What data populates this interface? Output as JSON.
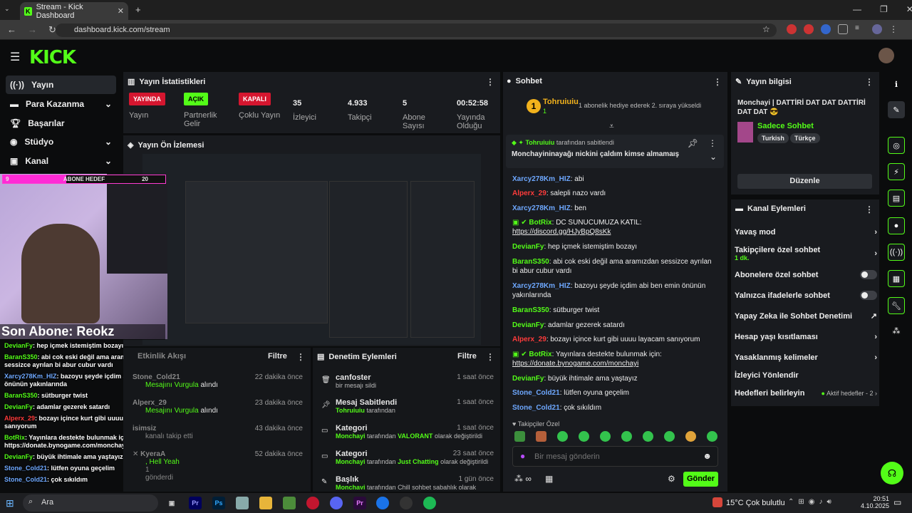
{
  "browser": {
    "tab_title": "Stream - Kick Dashboard",
    "url": "dashboard.kick.com/stream"
  },
  "brand": {
    "logo": "KICK",
    "accent": "#53fc18"
  },
  "sidebar": {
    "items": [
      {
        "label": "Yayın"
      },
      {
        "label": "Para Kazanma"
      },
      {
        "label": "Başarılar"
      },
      {
        "label": "Stüdyo"
      },
      {
        "label": "Kanal"
      }
    ]
  },
  "stats": {
    "title": "Yayın İstatistikleri",
    "items": [
      {
        "badge": "YAYINDA",
        "label": "Yayın"
      },
      {
        "badge": "AÇIK",
        "label": "Partnerlik Gelir"
      },
      {
        "badge": "KAPALI",
        "label": "Çoklu Yayın"
      },
      {
        "value": "35",
        "label": "İzleyici"
      },
      {
        "value": "4.933",
        "label": "Takipçi"
      },
      {
        "value": "5",
        "label": "Abone Sayısı"
      },
      {
        "value": "00:52:58",
        "label": "Yayında Olduğu"
      }
    ]
  },
  "preview": {
    "title": "Yayın Ön İzlemesi"
  },
  "overlay": {
    "goal_count": "9",
    "goal_label": "ABONE HEDEF",
    "goal_target": "20",
    "last_sub": "Son Abone: Reokz",
    "chat": [
      {
        "user": "DevianFy",
        "text": "hep içmek istemiştim bozayı"
      },
      {
        "user": "BaranS350",
        "text": "abi cok eski değil ama aramızdan sessizce ayrılan bi abur cubur vardı"
      },
      {
        "user": "Xarcy278Km_HIZ",
        "text": "bazoyu şeyde içdim abi ben emin önünün yakınlarında"
      },
      {
        "user": "BaranS350",
        "text": "sütburger twist"
      },
      {
        "user": "DevianFy",
        "text": "adamlar gezerek satardı"
      },
      {
        "user": "Alperx_29",
        "text": "bozayı içince kurt gibi uuuu layacam sanıyorum"
      },
      {
        "user": "BotRix",
        "text": "Yayınlara destekte bulunmak için: https://donate.bynogame.com/monchayi"
      },
      {
        "user": "DevianFy",
        "text": "büyük ihtimale ama yaştayız"
      },
      {
        "user": "Stone_Cold21",
        "text": "lütfen oyuna geçelim"
      },
      {
        "user": "Stone_Cold21",
        "text": "çok sıkıldım"
      }
    ]
  },
  "feed": {
    "title": "Etkinlik Akışı",
    "filter": "Filtre",
    "items": [
      {
        "user": "Stone_Cold21",
        "action": "Mesajını Vurgula",
        "suffix": "alındı",
        "time": "22 dakika önce"
      },
      {
        "user": "Alperx_29",
        "action": "Mesajını Vurgula",
        "suffix": "alındı",
        "time": "23 dakika önce"
      },
      {
        "user": "isimsiz",
        "action": "kanalı takip etti",
        "time": "43 dakika önce"
      },
      {
        "user": "KyeraA",
        "action": ", Hell Yeah",
        "extra": "1",
        "suffix": "gönderdi",
        "time": "52 dakika önce"
      }
    ]
  },
  "moderation": {
    "title": "Denetim Eylemleri",
    "filter": "Filtre",
    "items": [
      {
        "title": "canfoster",
        "desc": "bir mesajı sildi",
        "time": "1 saat önce"
      },
      {
        "title": "Mesaj Sabitlendi",
        "user": "Tohruiuiu",
        "desc": "tarafından",
        "time": "1 saat önce"
      },
      {
        "title": "Kategori",
        "user": "Monchayi",
        "desc": "tarafından",
        "hl": "VALORANT",
        "desc2": "olarak değiştirildi",
        "time": "1 saat önce"
      },
      {
        "title": "Kategori",
        "user": "Monchayi",
        "desc": "tarafından",
        "hl": "Just Chatting",
        "desc2": "olarak değiştirildi",
        "time": "23 saat önce"
      },
      {
        "title": "Başlık",
        "user": "Monchayi",
        "desc": "tarafından Chill sohbet sabahlık olarak",
        "time": "1 gün önce"
      }
    ]
  },
  "chat": {
    "title": "Sohbet",
    "gift_user": "Tohruiuiu",
    "gift_count": "1",
    "gift_text": "1 abonelik hediye ederek 2. sıraya yükseldi",
    "pinned_by": "Tohruiuiu",
    "pinned_suffix": "tarafından sabitlendi",
    "pinned_text": "Monchayininayağı nickini çaldım kimse almamaış",
    "messages": [
      {
        "user": "Xarcy278Km_HIZ",
        "color": "#6ea8ff",
        "text": "abi"
      },
      {
        "user": "Alperx_29",
        "color": "#ff3b3b",
        "text": "salepli nazo vardı"
      },
      {
        "user": "Xarcy278Km_HIZ",
        "color": "#6ea8ff",
        "text": "ben"
      },
      {
        "user": "BotRix",
        "color": "#53fc18",
        "text": "DC SUNUCUMUZA KATIL:",
        "link": "https://discord.gg/HJyBpQ8sKk"
      },
      {
        "user": "DevianFy",
        "color": "#53fc18",
        "text": "hep içmek istemiştim bozayı"
      },
      {
        "user": "BaranS350",
        "color": "#53fc18",
        "text": "abi cok eski değil ama aramızdan sessizce ayrılan bi abur cubur vardı"
      },
      {
        "user": "Xarcy278Km_HIZ",
        "color": "#6ea8ff",
        "text": "bazoyu şeyde içdim abi ben emin önünün yakınlarında"
      },
      {
        "user": "BaranS350",
        "color": "#53fc18",
        "text": "sütburger twist"
      },
      {
        "user": "DevianFy",
        "color": "#53fc18",
        "text": "adamlar gezerek satardı"
      },
      {
        "user": "Alperx_29",
        "color": "#ff3b3b",
        "text": "bozayı içince kurt gibi uuuu layacam sanıyorum"
      },
      {
        "user": "BotRix",
        "color": "#53fc18",
        "text": "Yayınlara destekte bulunmak için:",
        "link": "https://donate.bynogame.com/monchayi"
      },
      {
        "user": "DevianFy",
        "color": "#53fc18",
        "text": "büyük ihtimale ama yaştayız"
      },
      {
        "user": "Stone_Cold21",
        "color": "#6ea8ff",
        "text": "lütfen oyuna geçelim"
      },
      {
        "user": "Stone_Cold21",
        "color": "#6ea8ff",
        "text": "çok sıkıldım"
      }
    ],
    "follower_only": "Takipçiler Özel",
    "placeholder": "Bir mesaj gönderin",
    "send": "Gönder"
  },
  "info": {
    "title": "Yayın bilgisi",
    "stream_title": "Monchayi | DATTİRİ DAT DAT DATTİRİ DAT DAT 😎",
    "category": "Sadece Sohbet",
    "tags": [
      "Turkish",
      "Türkçe"
    ],
    "edit": "Düzenle"
  },
  "actions": {
    "title": "Kanal Eylemleri",
    "items": [
      {
        "label": "Yavaş mod"
      },
      {
        "label": "Takipçilere özel sohbet",
        "sub": "1 dk."
      },
      {
        "label": "Abonelere özel sohbet"
      },
      {
        "label": "Yalnızca ifadelerle sohbet"
      },
      {
        "label": "Yapay Zeka ile Sohbet Denetimi"
      },
      {
        "label": "Hesap yaşı kısıtlaması"
      },
      {
        "label": "Yasaklanmış kelimeler"
      },
      {
        "label": "İzleyici Yönlendir"
      },
      {
        "label": "Hedefleri belirleyin",
        "sub": "Aktif hedefler - 2"
      }
    ]
  },
  "taskbar": {
    "search": "Ara",
    "weather": "15°C  Çok bulutlu",
    "time": "20:51",
    "date": "4.10.2025"
  }
}
